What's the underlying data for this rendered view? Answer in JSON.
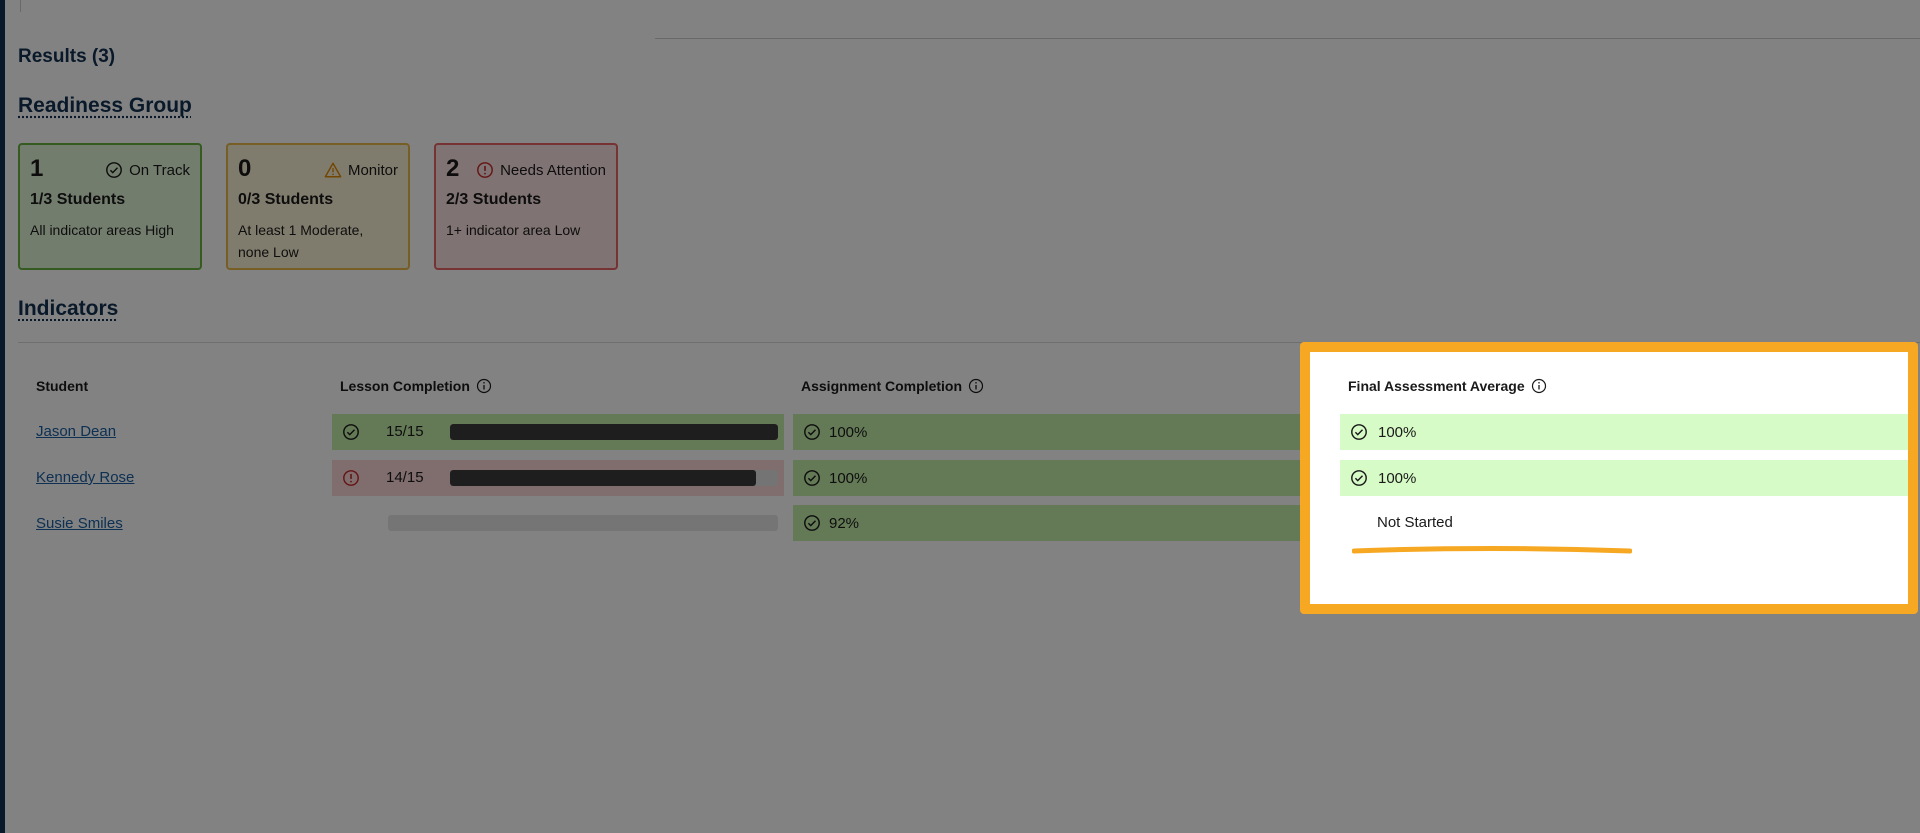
{
  "results_label": "Results (3)",
  "readiness_title": "Readiness Group",
  "indicators_title": "Indicators",
  "readiness_cards": [
    {
      "count": "1",
      "status": "On Track",
      "students": "1/3 Students",
      "description": "All indicator areas High",
      "icon": "check-circle-icon",
      "color": "#68b342"
    },
    {
      "count": "0",
      "status": "Monitor",
      "students": "0/3 Students",
      "description": "At least 1 Moderate, none Low",
      "icon": "warning-triangle-icon",
      "color": "#e8a02e"
    },
    {
      "count": "2",
      "status": "Needs Attention",
      "students": "2/3 Students",
      "description": "1+ indicator area Low",
      "icon": "alert-circle-icon",
      "color": "#d83b3b"
    }
  ],
  "table": {
    "headers": {
      "student": "Student",
      "lesson": "Lesson Completion",
      "assignment": "Assignment Completion",
      "final": "Final Assessment Average"
    },
    "rows": [
      {
        "name": "Jason Dean",
        "lesson_text": "15/15",
        "lesson_progress": 1.0,
        "lesson_status": "ok",
        "assignment": "100%",
        "final": "100%"
      },
      {
        "name": "Kennedy Rose",
        "lesson_text": "14/15",
        "lesson_progress": 0.933,
        "lesson_status": "alert",
        "assignment": "100%",
        "final": "100%"
      },
      {
        "name": "Susie Smiles",
        "lesson_text": "",
        "lesson_progress": 0,
        "lesson_status": "none",
        "assignment": "92%",
        "final": "Not Started"
      }
    ]
  },
  "colors": {
    "accent_highlight": "#f7a823",
    "on_track": "#68b342",
    "needs_attention": "#ea6565",
    "navy": "#123252"
  }
}
